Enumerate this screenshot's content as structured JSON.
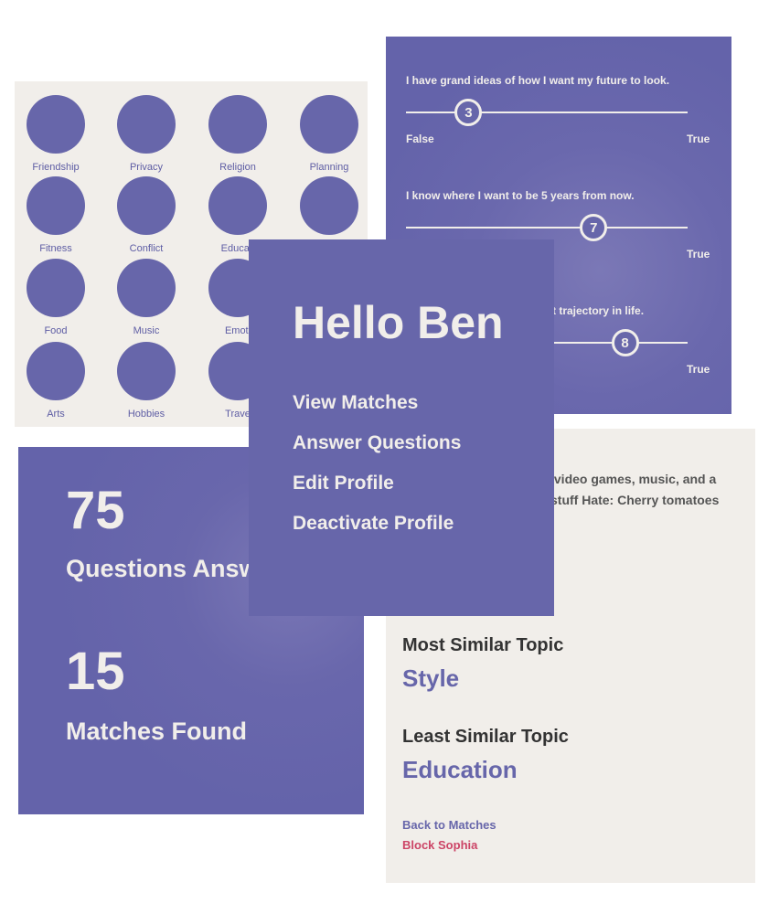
{
  "topics": [
    {
      "label": "Friendship"
    },
    {
      "label": "Privacy"
    },
    {
      "label": "Religion"
    },
    {
      "label": "Planning"
    },
    {
      "label": "Fitness"
    },
    {
      "label": "Conflict"
    },
    {
      "label": "Educati"
    },
    {
      "label": ""
    },
    {
      "label": "Food"
    },
    {
      "label": "Music"
    },
    {
      "label": "Emoti"
    },
    {
      "label": ""
    },
    {
      "label": "Arts"
    },
    {
      "label": "Hobbies"
    },
    {
      "label": "Trave"
    },
    {
      "label": ""
    }
  ],
  "sliders": [
    {
      "question": "I have grand ideas of how I want my future to look.",
      "value": "3",
      "level": 3,
      "left_label": "False",
      "right_label": "True"
    },
    {
      "question": "I know where I want to be 5 years from now.",
      "value": "7",
      "level": 7,
      "left_label": "",
      "right_label": "True"
    },
    {
      "question": "t trajectory in life.",
      "value": "8",
      "level": 8,
      "left_label": "",
      "right_label": "True"
    }
  ],
  "stats": {
    "questions_count": "75",
    "questions_label": "Questions Answ",
    "matches_count": "15",
    "matches_label": "Matches Found"
  },
  "menu": {
    "greeting": "Hello Ben",
    "items": [
      "View Matches",
      "Answer Questions",
      "Edit Profile",
      "Deactivate Profile"
    ]
  },
  "profile": {
    "bio_line1": "/video games, music, and a",
    "bio_line2": "stuff Hate: Cherry tomatoes",
    "most_similar_heading": "Most Similar Topic",
    "most_similar_value": "Style",
    "least_similar_heading": "Least Similar Topic",
    "least_similar_value": "Education",
    "back_link": "Back to Matches",
    "block_link": "Block Sophia"
  },
  "colors": {
    "purple": "#6766aa",
    "cream": "#f1eeea",
    "block_link": "#cc4466"
  }
}
